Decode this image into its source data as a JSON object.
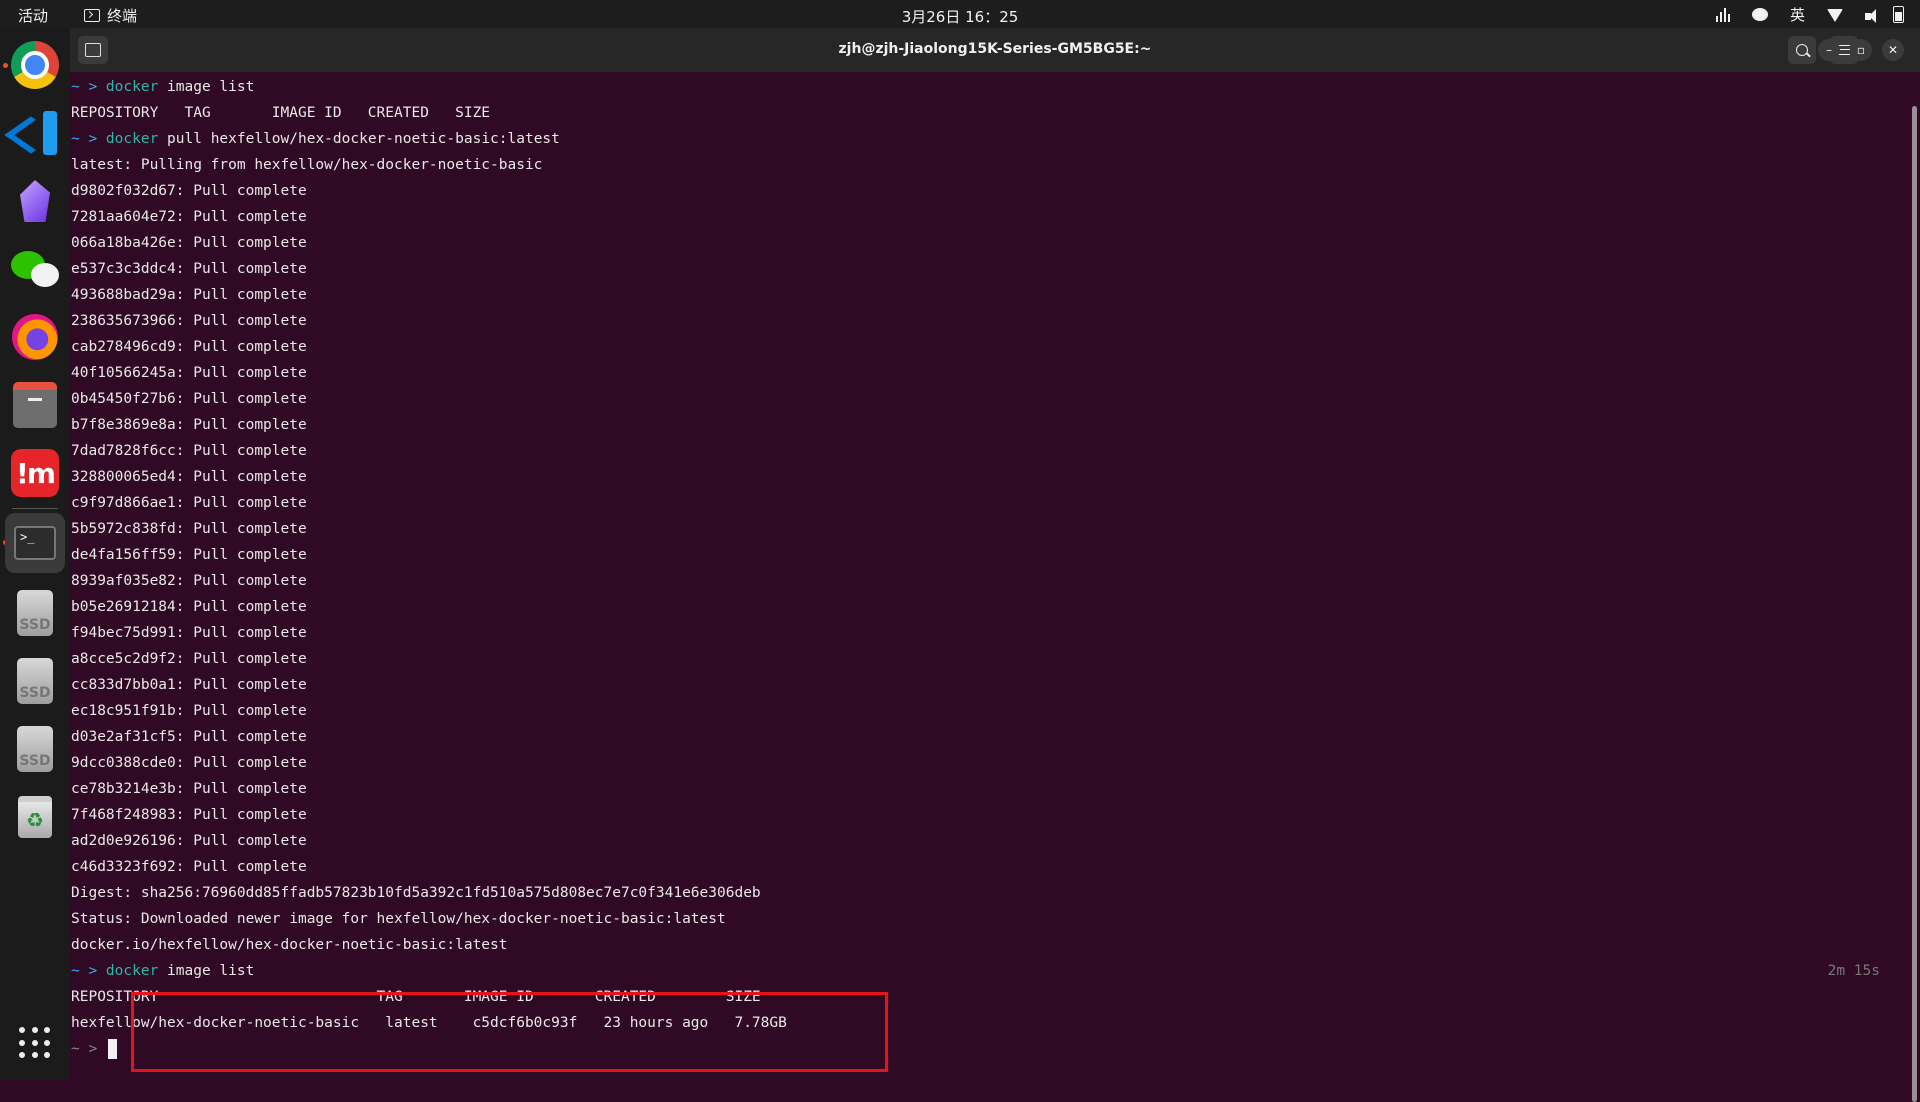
{
  "topbar": {
    "activities": "活动",
    "app_name": "终端",
    "clock": "3月26日  16：25",
    "ime": "英",
    "icons": [
      "bars-icon",
      "wechat-tray-icon",
      "ime-indicator",
      "wifi-icon",
      "volume-icon",
      "battery-icon"
    ]
  },
  "dock": {
    "items": [
      "chrome-icon",
      "vscode-icon",
      "obsidian-icon",
      "wechat-icon",
      "firefox-icon",
      "files-icon",
      "app-red-icon",
      "terminal-icon",
      "ssd-icon",
      "ssd-icon",
      "ssd-icon",
      "trash-icon",
      "app-grid-icon"
    ]
  },
  "window": {
    "title": "zjh@zjh-Jiaolong15K-Series-GM5BG5E:~"
  },
  "terminal": {
    "prompt": "~ > ",
    "cmd_word": "docker",
    "lines": [
      {
        "type": "cmd",
        "args": " image list"
      },
      {
        "type": "out",
        "text": "REPOSITORY   TAG       IMAGE ID   CREATED   SIZE"
      },
      {
        "type": "cmd",
        "args": " pull hexfellow/hex-docker-noetic-basic:latest"
      },
      {
        "type": "out",
        "text": "latest: Pulling from hexfellow/hex-docker-noetic-basic"
      },
      {
        "type": "out",
        "text": "d9802f032d67: Pull complete"
      },
      {
        "type": "out",
        "text": "7281aa604e72: Pull complete"
      },
      {
        "type": "out",
        "text": "066a18ba426e: Pull complete"
      },
      {
        "type": "out",
        "text": "e537c3c3ddc4: Pull complete"
      },
      {
        "type": "out",
        "text": "493688bad29a: Pull complete"
      },
      {
        "type": "out",
        "text": "238635673966: Pull complete"
      },
      {
        "type": "out",
        "text": "cab278496cd9: Pull complete"
      },
      {
        "type": "out",
        "text": "40f10566245a: Pull complete"
      },
      {
        "type": "out",
        "text": "0b45450f27b6: Pull complete"
      },
      {
        "type": "out",
        "text": "b7f8e3869e8a: Pull complete"
      },
      {
        "type": "out",
        "text": "7dad7828f6cc: Pull complete"
      },
      {
        "type": "out",
        "text": "328800065ed4: Pull complete"
      },
      {
        "type": "out",
        "text": "c9f97d866ae1: Pull complete"
      },
      {
        "type": "out",
        "text": "5b5972c838fd: Pull complete"
      },
      {
        "type": "out",
        "text": "de4fa156ff59: Pull complete"
      },
      {
        "type": "out",
        "text": "8939af035e82: Pull complete"
      },
      {
        "type": "out",
        "text": "b05e26912184: Pull complete"
      },
      {
        "type": "out",
        "text": "f94bec75d991: Pull complete"
      },
      {
        "type": "out",
        "text": "a8cce5c2d9f2: Pull complete"
      },
      {
        "type": "out",
        "text": "cc833d7bb0a1: Pull complete"
      },
      {
        "type": "out",
        "text": "ec18c951f91b: Pull complete"
      },
      {
        "type": "out",
        "text": "d03e2af31cf5: Pull complete"
      },
      {
        "type": "out",
        "text": "9dcc0388cde0: Pull complete"
      },
      {
        "type": "out",
        "text": "ce78b3214e3b: Pull complete"
      },
      {
        "type": "out",
        "text": "7f468f248983: Pull complete"
      },
      {
        "type": "out",
        "text": "ad2d0e926196: Pull complete"
      },
      {
        "type": "out",
        "text": "c46d3323f692: Pull complete"
      },
      {
        "type": "out",
        "text": "Digest: sha256:76960dd85ffadb57823b10fd5a392c1fd510a575d808ec7e7c0f341e6e306deb"
      },
      {
        "type": "out",
        "text": "Status: Downloaded newer image for hexfellow/hex-docker-noetic-basic:latest"
      },
      {
        "type": "out",
        "text": "docker.io/hexfellow/hex-docker-noetic-basic:latest"
      },
      {
        "type": "cmd",
        "args": " image list",
        "elapsed": "2m 15s"
      },
      {
        "type": "out",
        "text": "REPOSITORY                         TAG       IMAGE ID       CREATED        SIZE"
      },
      {
        "type": "out",
        "text": "hexfellow/hex-docker-noetic-basic   latest    c5dcf6b0c93f   23 hours ago   7.78GB"
      },
      {
        "type": "cursor"
      }
    ]
  },
  "colors": {
    "terminal_bg": "#300a24",
    "prompt": "#3da8f5",
    "command": "#2fb6a8",
    "highlight_box": "#e5141c"
  }
}
